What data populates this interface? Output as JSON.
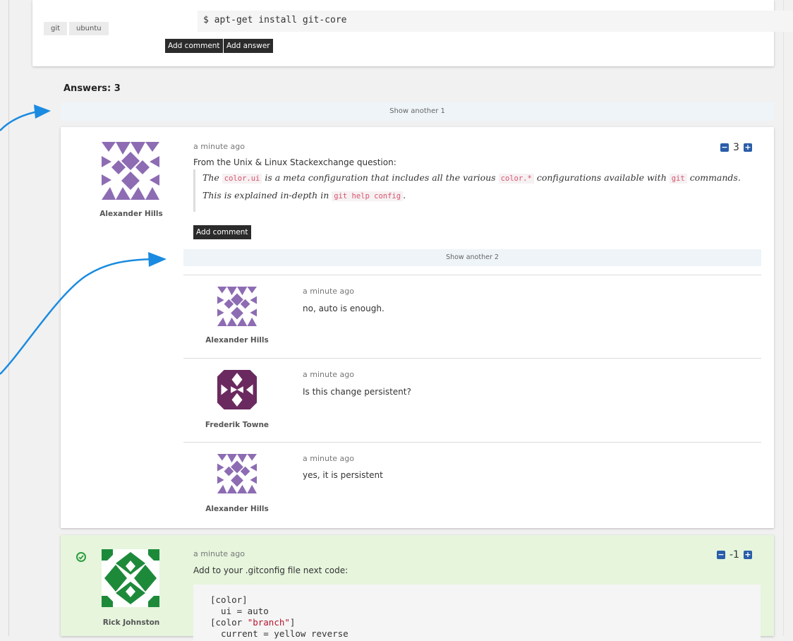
{
  "question": {
    "tags": [
      "git",
      "ubuntu"
    ],
    "code": "$ apt-get install git-core",
    "add_comment_label": "Add comment",
    "add_answer_label": "Add answer"
  },
  "answers_header": "Answers: 3",
  "show_another_answers": "Show another 1",
  "answer1": {
    "author": "Alexander Hills",
    "timestamp": "a minute ago",
    "intro": "From the Unix & Linux Stackexchange question:",
    "quote": {
      "the": "The",
      "code1": "color.ui",
      "text1": "is a meta configuration that includes all the various",
      "code2": "color.*",
      "text2": "configurations available with",
      "code3": "git",
      "text3": "commands.",
      "text4": "This is explained in-depth in",
      "code4": "git help config",
      "text5": "."
    },
    "votes": "3",
    "add_comment_label": "Add comment",
    "show_another_comments": "Show another 2",
    "comments": [
      {
        "author": "Alexander Hills",
        "timestamp": "a minute ago",
        "text": "no, auto is enough."
      },
      {
        "author": "Frederik Towne",
        "timestamp": "a minute ago",
        "text": "Is this change persistent?"
      },
      {
        "author": "Alexander Hills",
        "timestamp": "a minute ago",
        "text": "yes, it is persistent"
      }
    ]
  },
  "answer2": {
    "author": "Rick Johnston",
    "timestamp": "a minute ago",
    "text": "Add to your .gitconfig file next code:",
    "votes": "-1",
    "accepted": true,
    "code_lines": {
      "l1": "[color]",
      "l2": "  ui = auto",
      "l3a": "[color ",
      "l3b": "\"branch\"",
      "l3c": "]",
      "l4": "  current = yellow reverse"
    }
  },
  "colors": {
    "vote_button": "#2a5da9",
    "accepted_bg": "#e6f5dc",
    "accepted_check": "#2e9e3e",
    "arrow": "#1a8be0",
    "avatar_purple": "#8d6cb3",
    "avatar_dark_purple": "#6a2a5f",
    "avatar_green": "#1d8a3a"
  },
  "icons": [
    "minus-icon",
    "plus-icon",
    "check-circle-icon"
  ]
}
